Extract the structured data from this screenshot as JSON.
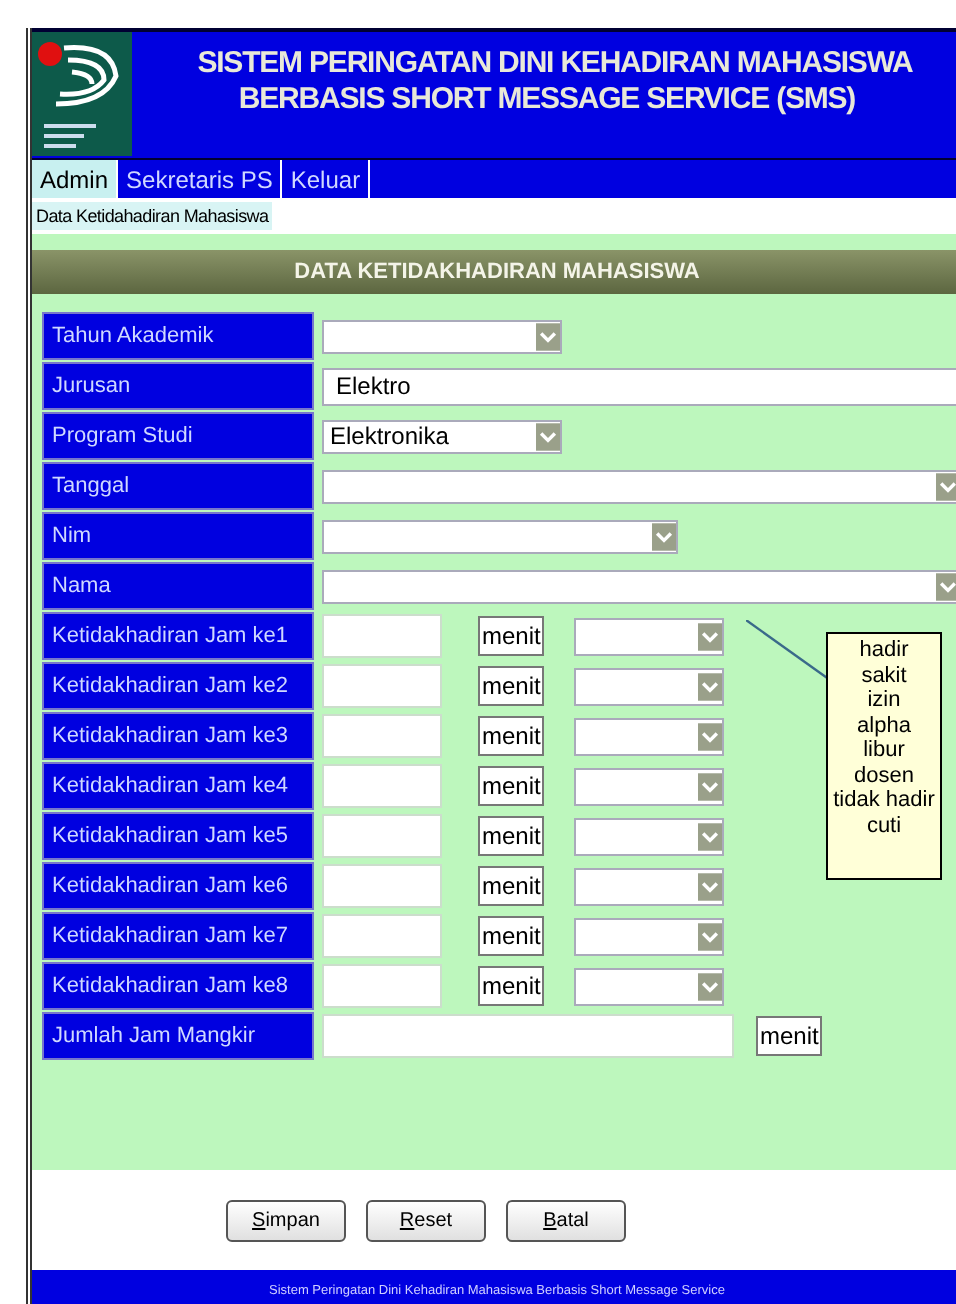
{
  "header": {
    "title": "SISTEM PERINGATAN DINI KEHADIRAN MAHASISWA",
    "subtitle": "BERBASIS SHORT MESSAGE SERVICE (SMS)"
  },
  "menu": [
    {
      "label": "Admin",
      "selected": true
    },
    {
      "label": "Sekretaris PS",
      "selected": false
    },
    {
      "label": "Keluar",
      "selected": false
    }
  ],
  "breadcrumb": "Data Ketidahadiran Mahasiswa",
  "panel_title": "DATA KETIDAKHADIRAN MAHASISWA",
  "fields": [
    {
      "kind": "select",
      "label": "Tahun Akademik"
    },
    {
      "kind": "text",
      "label": "Jurusan",
      "value": "Elektro"
    },
    {
      "kind": "select",
      "label": "Program Studi",
      "value": "Elektronika"
    },
    {
      "kind": "select",
      "label": "Tanggal"
    },
    {
      "kind": "select",
      "label": "Nim"
    },
    {
      "kind": "select",
      "label": "Nama"
    },
    {
      "kind": "hour",
      "label": "Ketidakhadiran Jam ke1",
      "unit": "menit"
    },
    {
      "kind": "hour",
      "label": "Ketidakhadiran Jam ke2",
      "unit": "menit"
    },
    {
      "kind": "hour",
      "label": "Ketidakhadiran Jam ke3",
      "unit": "menit"
    },
    {
      "kind": "hour",
      "label": "Ketidakhadiran Jam ke4",
      "unit": "menit"
    },
    {
      "kind": "hour",
      "label": "Ketidakhadiran Jam ke5",
      "unit": "menit"
    },
    {
      "kind": "hour",
      "label": "Ketidakhadiran Jam ke6",
      "unit": "menit"
    },
    {
      "kind": "hour",
      "label": "Ketidakhadiran Jam ke7",
      "unit": "menit"
    },
    {
      "kind": "hour",
      "label": "Ketidakhadiran Jam ke8",
      "unit": "menit"
    },
    {
      "kind": "total",
      "label": "Jumlah Jam Mangkir",
      "unit": "menit"
    }
  ],
  "note": [
    "hadir",
    "sakit",
    "izin",
    "alpha",
    "libur",
    "dosen",
    "tidak hadir",
    "cuti"
  ],
  "buttons": [
    "Simpan",
    "Reset",
    "Batal"
  ],
  "footer": "Sistem Peringatan Dini Kehadiran Mahasiswa Berbasis Short Message Service"
}
